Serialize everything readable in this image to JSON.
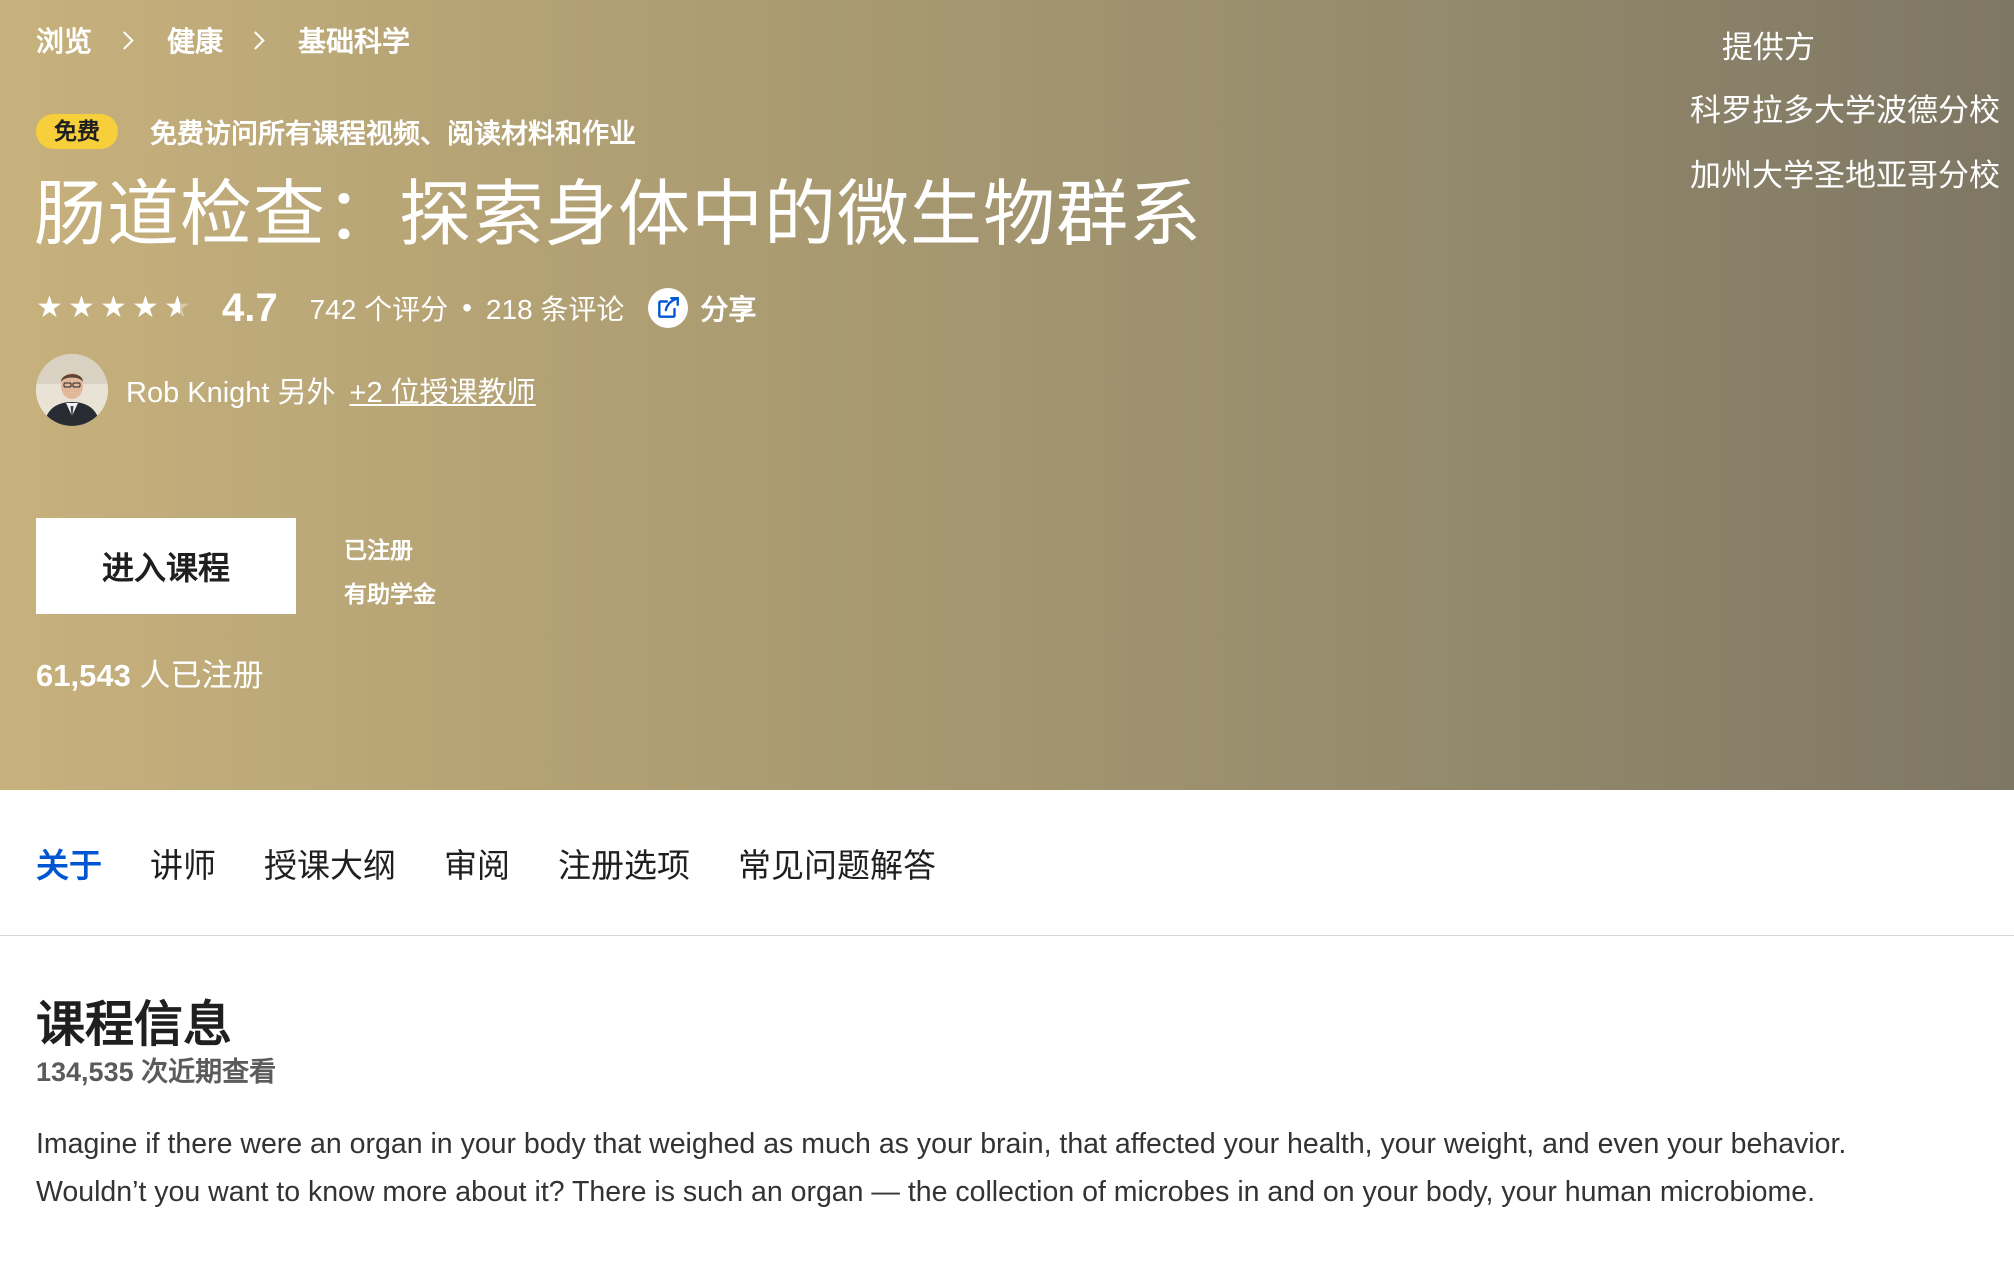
{
  "breadcrumb": [
    "浏览",
    "健康",
    "基础科学"
  ],
  "badge": "免费",
  "free_text": "免费访问所有课程视频、阅读材料和作业",
  "title": "肠道检查：探索身体中的微生物群系",
  "rating": {
    "value": "4.7",
    "stars": 4.5,
    "count": "742 个评分",
    "separator": "•",
    "reviews": "218 条评论"
  },
  "share_label": "分享",
  "instructors": {
    "name": "Rob Knight 另外",
    "more": "+2 位授课教师"
  },
  "enroll": {
    "button": "进入课程",
    "status": "已注册",
    "aid": "有助学金",
    "count_number": "61,543",
    "count_suffix": " 人已注册"
  },
  "provider": {
    "label": "提供方",
    "items": [
      "科罗拉多大学波德分校",
      "加州大学圣地亚哥分校"
    ]
  },
  "tabs": [
    {
      "label": "关于",
      "active": true
    },
    {
      "label": "讲师",
      "active": false
    },
    {
      "label": "授课大纲",
      "active": false
    },
    {
      "label": "审阅",
      "active": false
    },
    {
      "label": "注册选项",
      "active": false
    },
    {
      "label": "常见问题解答",
      "active": false
    }
  ],
  "about": {
    "heading": "课程信息",
    "views": "134,535 次近期查看",
    "description": "Imagine if there were an organ in your body that weighed as much as your brain, that affected your health, your weight, and even your behavior. Wouldn’t you want to know more about it? There is such an organ — the collection of microbes in and on your body, your human microbiome."
  },
  "colors": {
    "accent": "#0056d2",
    "badge": "#f6cf3a",
    "hero_start": "#c7b17d",
    "hero_end": "#7e7764"
  }
}
